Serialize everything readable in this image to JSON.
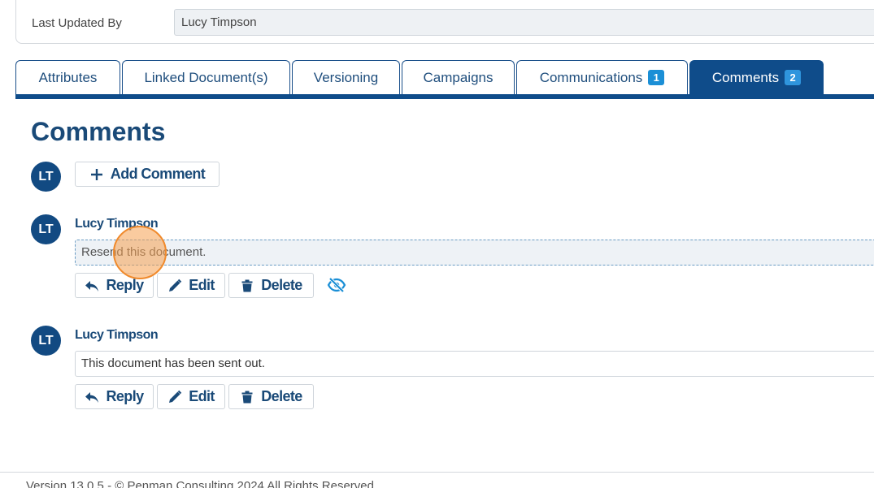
{
  "record": {
    "last_updated_by_label": "Last Updated By",
    "last_updated_by_value": "Lucy Timpson"
  },
  "tabs": [
    {
      "label": "Attributes",
      "badge": ""
    },
    {
      "label": "Linked Document(s)",
      "badge": ""
    },
    {
      "label": "Versioning",
      "badge": ""
    },
    {
      "label": "Campaigns",
      "badge": ""
    },
    {
      "label": "Communications",
      "badge": "1"
    },
    {
      "label": "Comments",
      "badge": "2",
      "active": true
    }
  ],
  "comments_section": {
    "title": "Comments",
    "current_user_initials": "LT",
    "add_comment_label": "Add Comment",
    "reply_label": "Reply",
    "edit_label": "Edit",
    "delete_label": "Delete",
    "items": [
      {
        "initials": "LT",
        "author": "Lucy Timpson",
        "text": "Resend this document.",
        "hidden_icon": "eye-slash-icon"
      },
      {
        "initials": "LT",
        "author": "Lucy Timpson",
        "text": "This document has been sent out."
      }
    ]
  },
  "colors": {
    "primary": "#0f4c8a",
    "badge": "#1b8fd6",
    "heading": "#1a4a78"
  },
  "footer": {
    "text": "Version 13.0.5 - © Penman Consulting 2024 All Rights Reserved"
  }
}
